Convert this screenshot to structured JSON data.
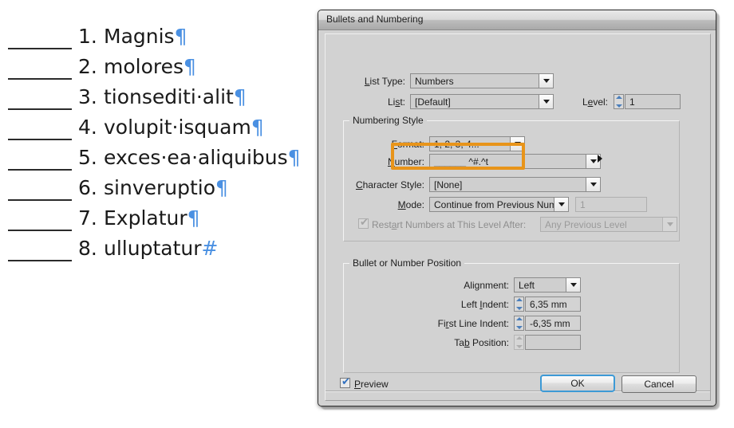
{
  "document": {
    "list_items": [
      {
        "rule": "______",
        "number": "1.",
        "text": "Magnis",
        "end_mark": "¶"
      },
      {
        "rule": "______",
        "number": "2.",
        "text": "molores",
        "end_mark": "¶"
      },
      {
        "rule": "______",
        "number": "3.",
        "text": "tionsediti·alit",
        "end_mark": "¶"
      },
      {
        "rule": "______",
        "number": "4.",
        "text": "volupit·isquam",
        "end_mark": "¶"
      },
      {
        "rule": "______",
        "number": "5.",
        "text": "exces·ea·aliquibus",
        "end_mark": "¶"
      },
      {
        "rule": "______",
        "number": "6.",
        "text": "sinveruptio",
        "end_mark": "¶"
      },
      {
        "rule": "______",
        "number": "7.",
        "text": "Explatur",
        "end_mark": "¶"
      },
      {
        "rule": "______",
        "number": "8.",
        "text": "ulluptatur",
        "end_mark": "#"
      }
    ]
  },
  "dialog": {
    "title": "Bullets and Numbering",
    "list_type": {
      "label": "List Type:",
      "value": "Numbers"
    },
    "list": {
      "label": "List:",
      "value": "[Default]"
    },
    "level": {
      "label": "Level:",
      "value": "1"
    },
    "numbering_style": {
      "group_title": "Numbering Style",
      "format": {
        "label": "Format:",
        "value": "1, 2, 3, 4..."
      },
      "number": {
        "label": "Number:",
        "value": "______ ^#.^t"
      },
      "character_style": {
        "label": "Character Style:",
        "value": "[None]"
      },
      "mode": {
        "label": "Mode:",
        "value": "Continue from Previous Numbe",
        "start_at": "1"
      },
      "restart": {
        "label": "Restart Numbers at This Level After:",
        "value": "Any Previous Level",
        "checked": true,
        "enabled": false
      }
    },
    "position": {
      "group_title": "Bullet or Number Position",
      "alignment": {
        "label": "Alignment:",
        "value": "Left"
      },
      "left_indent": {
        "label": "Left Indent:",
        "value": "6,35 mm"
      },
      "first_line_indent": {
        "label": "First Line Indent:",
        "value": "-6,35 mm"
      },
      "tab_position": {
        "label": "Tab Position:",
        "value": ""
      }
    },
    "footer": {
      "preview_label": "Preview",
      "preview_checked": true,
      "ok_label": "OK",
      "cancel_label": "Cancel"
    }
  },
  "colors": {
    "highlight_orange": "#e8941a",
    "pilcrow_blue": "#4a90e2",
    "focus_blue": "#3d9ad6",
    "dialog_face": "#d2d2d2"
  }
}
